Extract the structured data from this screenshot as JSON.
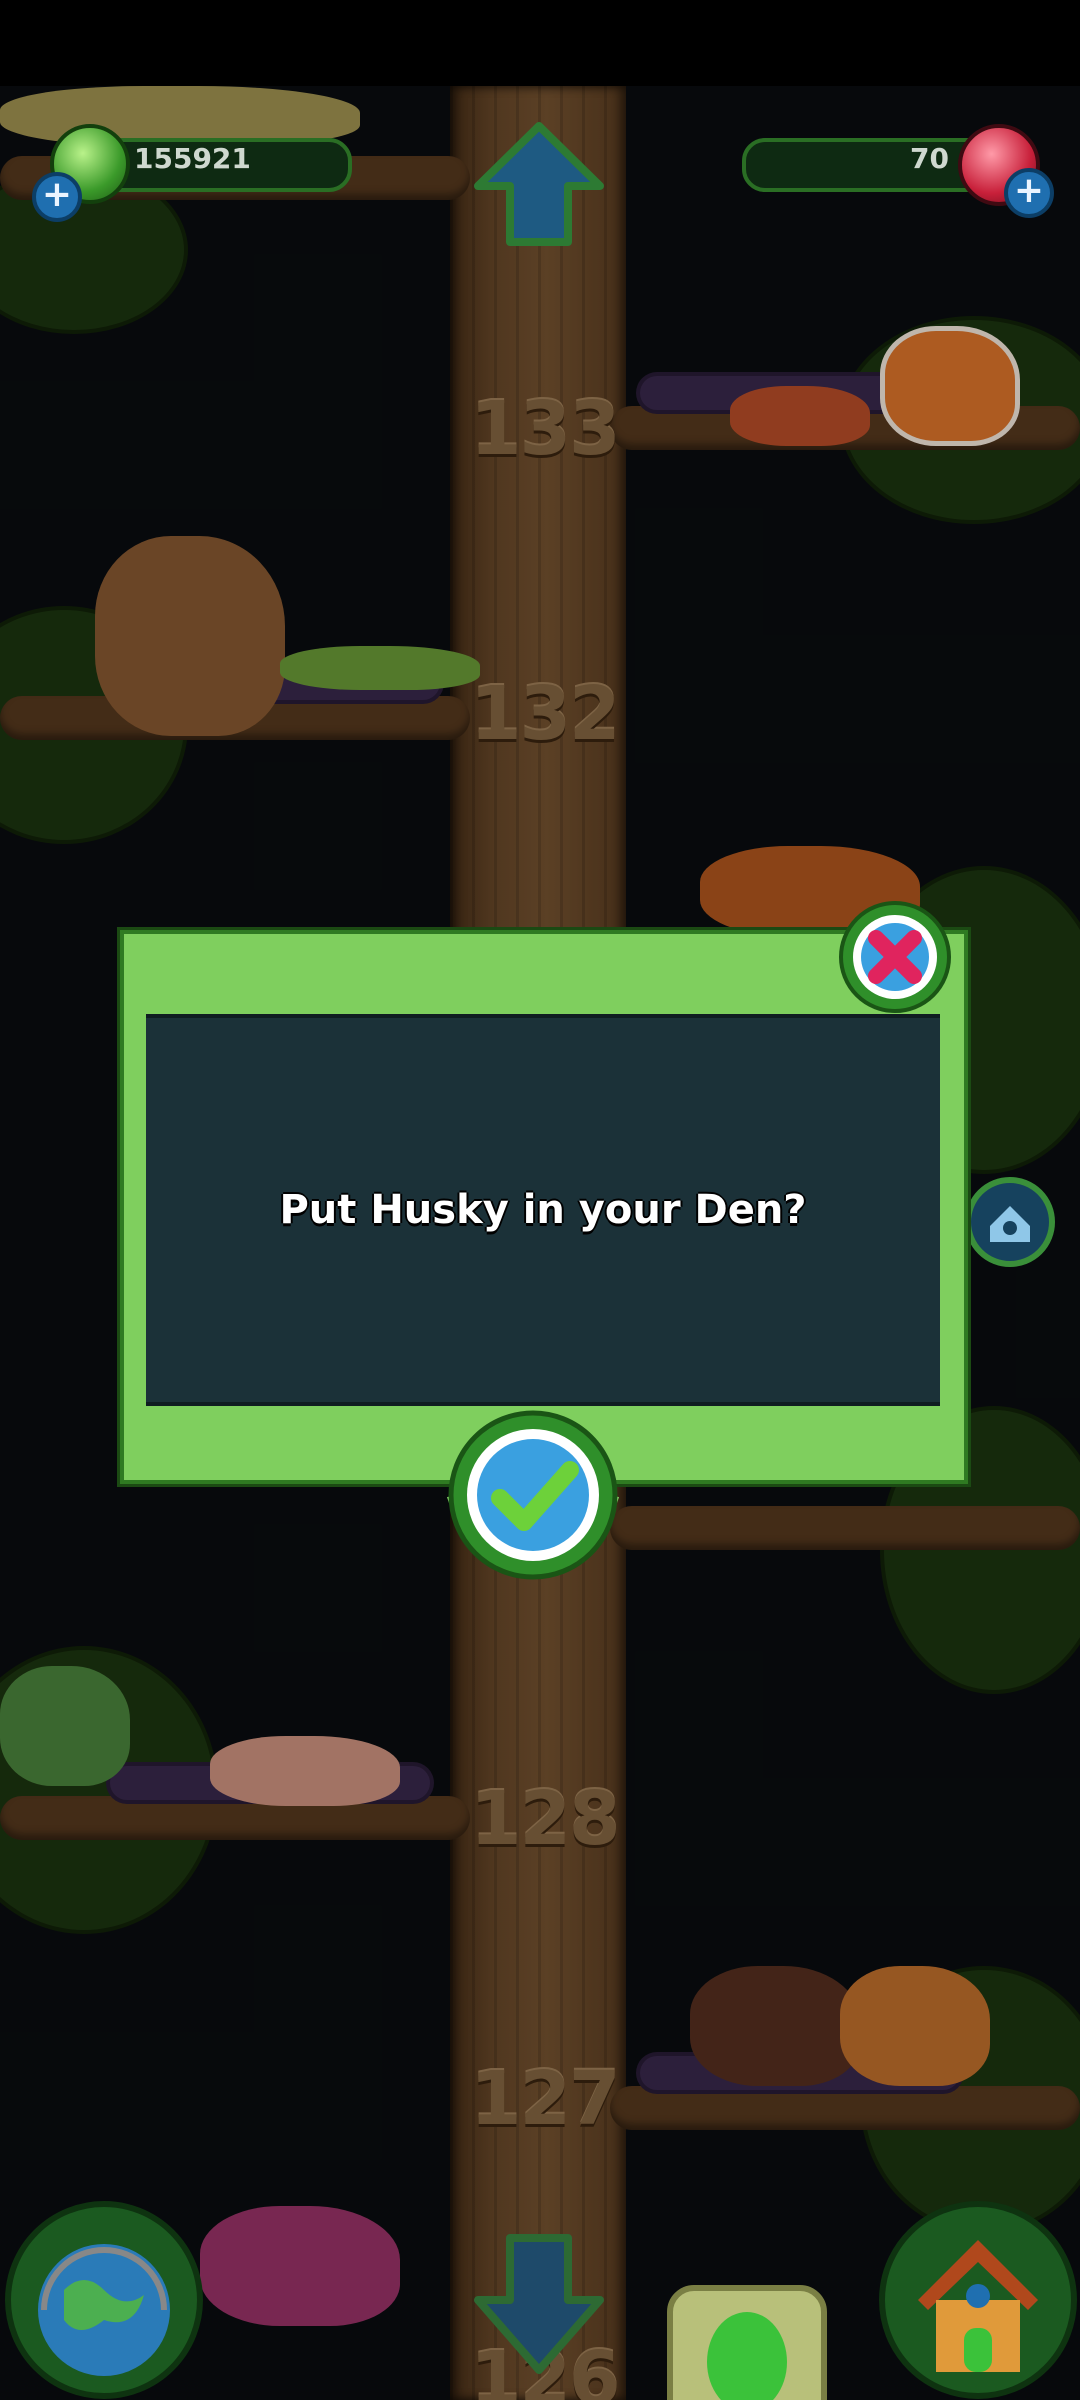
{
  "hud": {
    "gems_value": "155921",
    "crystals_value": "70"
  },
  "levels": {
    "l133": "133",
    "l132": "132",
    "l128": "128",
    "l127": "127",
    "l126": "126"
  },
  "dialog": {
    "message": "Put Husky in your Den?"
  },
  "colors": {
    "dialog_frame": "#7fcf5e",
    "dialog_panel": "#1b3138",
    "close_accent": "#e0245e",
    "confirm_accent": "#3aa0e0"
  },
  "icons": [
    "gem-icon",
    "crystal-icon",
    "up-arrow-icon",
    "down-arrow-icon",
    "close-icon",
    "checkmark-icon",
    "den-icon",
    "globe-icon",
    "house-icon",
    "plus-icon"
  ]
}
